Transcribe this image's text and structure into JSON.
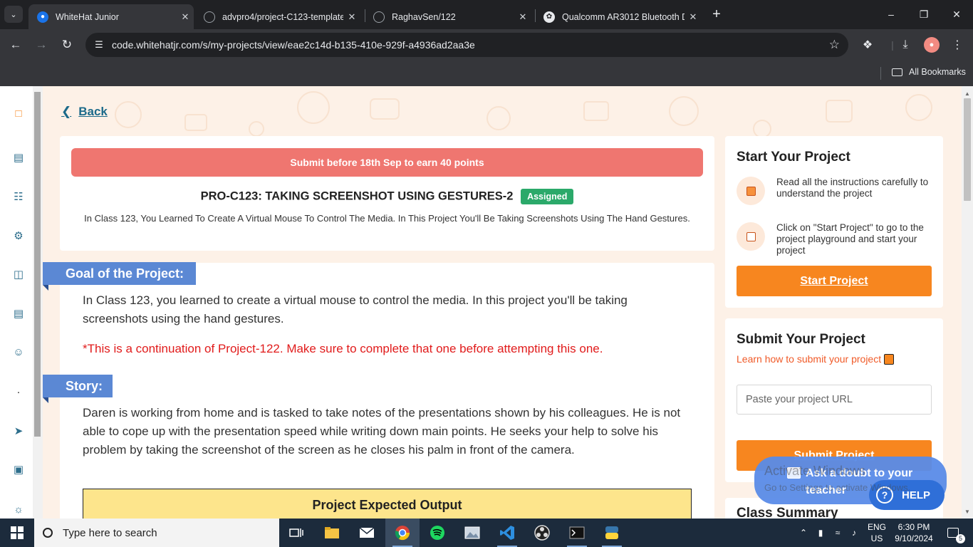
{
  "browser": {
    "tabs": [
      {
        "title": "WhiteHat Junior",
        "active": true
      },
      {
        "title": "advpro4/project-C123-template",
        "active": false
      },
      {
        "title": "RaghavSen/122",
        "active": false
      },
      {
        "title": "Qualcomm AR3012 Bluetooth D",
        "active": false
      }
    ],
    "url": "code.whitehatjr.com/s/my-projects/view/eae2c14d-b135-410e-929f-a4936ad2aa3e",
    "bookmarks_label": "All Bookmarks"
  },
  "page": {
    "back_label": "Back",
    "banner": "Submit before 18th Sep to earn 40 points",
    "project_title": "PRO-C123: TAKING SCREENSHOT USING GESTURES-2",
    "status_badge": "Assigned",
    "project_description": "In Class 123, You Learned To Create A Virtual Mouse To Control The Media. In This Project You'll Be Taking Screenshots Using The Hand Gestures.",
    "goal_label": "Goal of the Project:",
    "goal_text": "In Class 123, you learned to create a virtual mouse to control the media. In this project you'll be taking screenshots using the hand gestures.",
    "goal_note": "*This is a continuation of Project-122. Make sure to complete that one before attempting this one.",
    "story_label": "Story:",
    "story_text": "Daren is working from home and is tasked to take notes of the presentations shown by his colleagues. He is not able to cope up with the presentation speed while writing down main points. He seeks your help to solve his problem by taking the screenshot of the screen as he closes his palm in front of the camera.",
    "expected_output_label": "Project Expected Output"
  },
  "sidebar_start": {
    "heading": "Start Your Project",
    "step1": "Read all the instructions carefully to understand the project",
    "step2": "Click on \"Start Project\" to go to the project playground and start your project",
    "button": "Start Project"
  },
  "sidebar_submit": {
    "heading": "Submit Your Project",
    "learn_link": "Learn how to submit your project",
    "url_placeholder": "Paste your project URL",
    "button": "Submit Project"
  },
  "sidebar_class": {
    "heading": "Class Summary"
  },
  "widgets": {
    "doubt": "Ask a doubt to your teacher",
    "help": "HELP"
  },
  "watermark": {
    "line1": "Activate Windows",
    "line2": "Go to Settings to activate Windows."
  },
  "taskbar": {
    "search_placeholder": "Type here to search",
    "lang1": "ENG",
    "lang2": "US",
    "time": "6:30 PM",
    "date": "9/10/2024",
    "notifications": "5"
  },
  "colors": {
    "brand_orange": "#f7861f",
    "banner_red": "#ef7670",
    "label_blue": "#5b88d4",
    "assigned_green": "#2ba96a",
    "note_red": "#e11b1b"
  }
}
